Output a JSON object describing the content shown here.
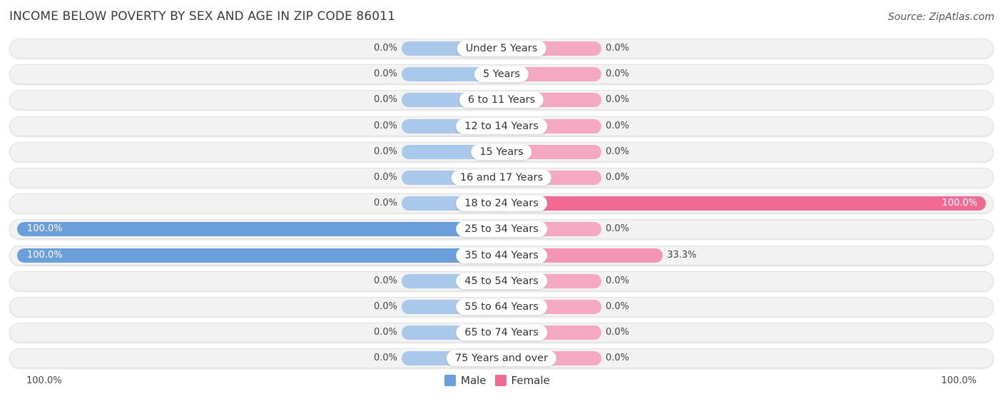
{
  "header": {
    "title": "INCOME BELOW POVERTY BY SEX AND AGE IN ZIP CODE 86011",
    "source": "Source: ZipAtlas.com"
  },
  "colors": {
    "male_light": "#a9c8ea",
    "male_full": "#6a9fdc",
    "female_light": "#f5a8c2",
    "female_full": "#f06a94"
  },
  "chart_data": {
    "type": "bar",
    "orientation": "horizontal-diverging",
    "title": "INCOME BELOW POVERTY BY SEX AND AGE IN ZIP CODE 86011",
    "categories": [
      "Under 5 Years",
      "5 Years",
      "6 to 11 Years",
      "12 to 14 Years",
      "15 Years",
      "16 and 17 Years",
      "18 to 24 Years",
      "25 to 34 Years",
      "35 to 44 Years",
      "45 to 54 Years",
      "55 to 64 Years",
      "65 to 74 Years",
      "75 Years and over"
    ],
    "series": [
      {
        "name": "Male",
        "values": [
          0,
          0,
          0,
          0,
          0,
          0,
          0,
          100,
          100,
          0,
          0,
          0,
          0
        ],
        "labels": [
          "0.0%",
          "0.0%",
          "0.0%",
          "0.0%",
          "0.0%",
          "0.0%",
          "0.0%",
          "100.0%",
          "100.0%",
          "0.0%",
          "0.0%",
          "0.0%",
          "0.0%"
        ]
      },
      {
        "name": "Female",
        "values": [
          0,
          0,
          0,
          0,
          0,
          0,
          100,
          0,
          33.3,
          0,
          0,
          0,
          0
        ],
        "labels": [
          "0.0%",
          "0.0%",
          "0.0%",
          "0.0%",
          "0.0%",
          "0.0%",
          "100.0%",
          "0.0%",
          "33.3%",
          "0.0%",
          "0.0%",
          "0.0%",
          "0.0%"
        ]
      }
    ],
    "xlim": [
      -100,
      100
    ],
    "axis_labels": {
      "left": "100.0%",
      "right": "100.0%"
    },
    "legend": {
      "position": "bottom-center",
      "entries": [
        "Male",
        "Female"
      ]
    },
    "unit": "%"
  }
}
